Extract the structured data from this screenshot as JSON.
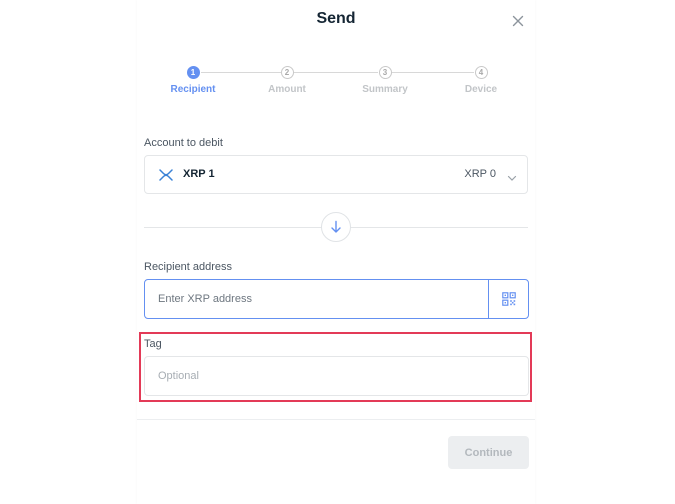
{
  "modal": {
    "title": "Send",
    "close_icon": "close-icon"
  },
  "stepper": {
    "steps": [
      {
        "number": "1",
        "label": "Recipient",
        "active": true
      },
      {
        "number": "2",
        "label": "Amount",
        "active": false
      },
      {
        "number": "3",
        "label": "Summary",
        "active": false
      },
      {
        "number": "4",
        "label": "Device",
        "active": false
      }
    ]
  },
  "account": {
    "label": "Account to debit",
    "name": "XRP 1",
    "balance": "XRP 0",
    "icon": "xrp-icon"
  },
  "recipient": {
    "label": "Recipient address",
    "placeholder": "Enter XRP address",
    "value": "",
    "qr_icon": "qr-code-icon"
  },
  "tag": {
    "label": "Tag",
    "placeholder": "Optional",
    "value": ""
  },
  "footer": {
    "continue_label": "Continue"
  },
  "colors": {
    "accent": "#6490f1",
    "highlight": "#e33a57",
    "text": "#142533",
    "disabled": "#eceef0"
  }
}
